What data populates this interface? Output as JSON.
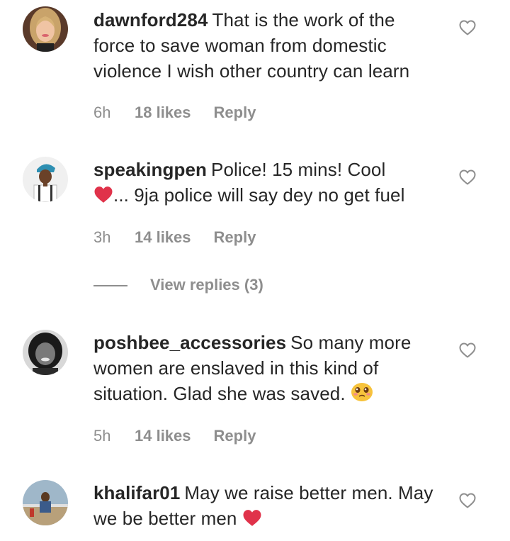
{
  "comments": [
    {
      "username": "dawnford284",
      "text": "That is the work of the force to save woman from domestic violence I wish other country can learn",
      "time": "6h",
      "likes": "18 likes",
      "reply": "Reply"
    },
    {
      "username": "speakingpen",
      "text_a": "Police! 15 mins! Cool",
      "text_b": "... 9ja police will say dey no get fuel",
      "time": "3h",
      "likes": "14 likes",
      "reply": "Reply",
      "view_replies": "View replies (3)"
    },
    {
      "username": "poshbee_accessories",
      "text": "So many more women are enslaved in this kind of situation. Glad she was saved.",
      "time": "5h",
      "likes": "14 likes",
      "reply": "Reply"
    },
    {
      "username": "khalifar01",
      "text": "May we raise better men. May we be better men",
      "time": "",
      "likes": "",
      "reply": ""
    }
  ],
  "icons": {
    "like": "heart-outline-icon",
    "emoji_red_heart": "red-heart-emoji",
    "emoji_pleading": "pleading-face-emoji"
  },
  "colors": {
    "text": "#262626",
    "secondary": "#8e8e8e",
    "heart_red": "#e0324a",
    "emoji_yellow": "#f7c33c"
  }
}
